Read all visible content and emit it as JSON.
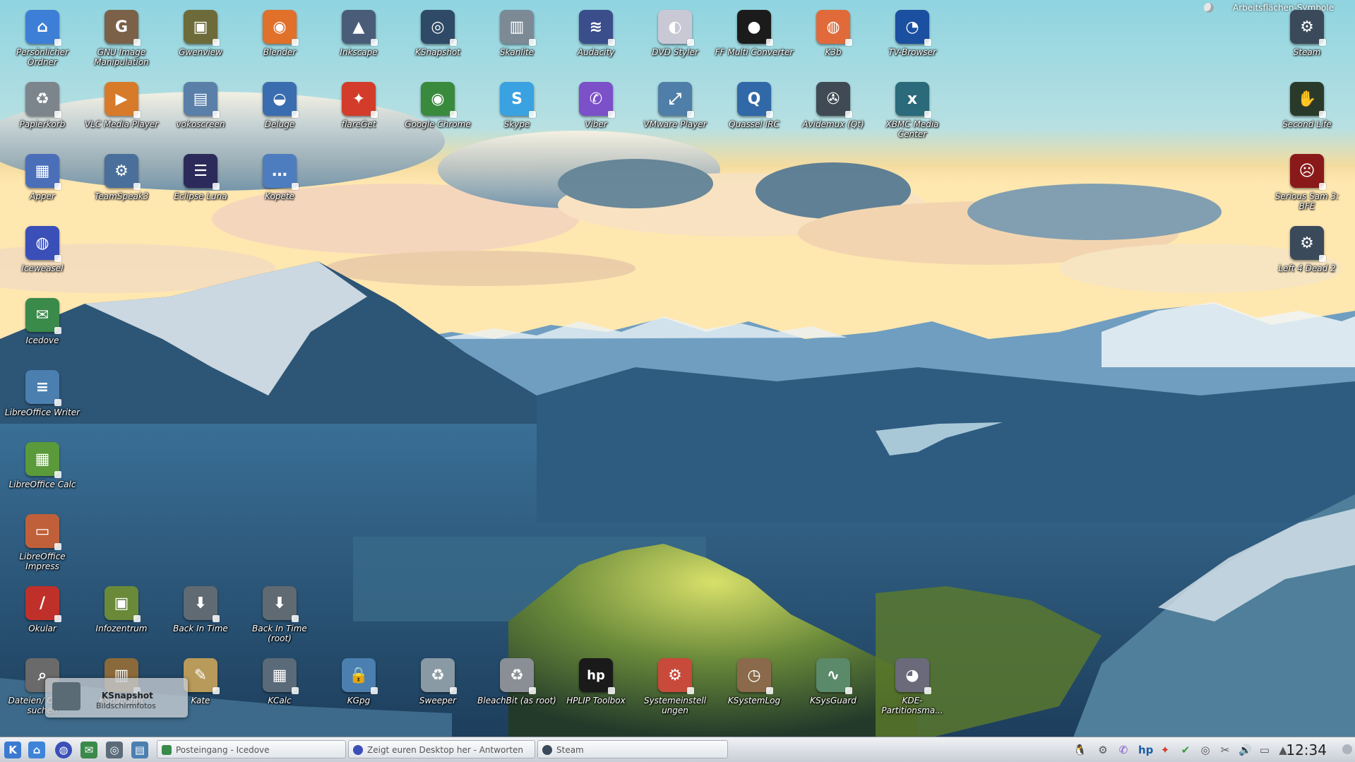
{
  "desktop": {
    "folderview_label": "Arbeitsflächen-Symbole",
    "icons": [
      {
        "id": "persoenlicher-ordner",
        "label": "Persönlicher Ordner",
        "color": "#3d7fd6",
        "glyph": "⌂"
      },
      {
        "id": "gimp",
        "label": "GNU Image Manipulation",
        "color": "#7a6148",
        "glyph": "G"
      },
      {
        "id": "gwenview",
        "label": "Gwenview",
        "color": "#6d6b3a",
        "glyph": "▣"
      },
      {
        "id": "blender",
        "label": "Blender",
        "color": "#e0702a",
        "glyph": "◉"
      },
      {
        "id": "inkscape",
        "label": "Inkscape",
        "color": "#4a5d78",
        "glyph": "▲"
      },
      {
        "id": "ksnapshot",
        "label": "KSnapshot",
        "color": "#2f4a66",
        "glyph": "◎"
      },
      {
        "id": "skanlite",
        "label": "Skanlite",
        "color": "#7c8a96",
        "glyph": "▥"
      },
      {
        "id": "audacity",
        "label": "Audacity",
        "color": "#3a4e8c",
        "glyph": "≋"
      },
      {
        "id": "dvd-styler",
        "label": "DVD Styler",
        "color": "#c9c9d6",
        "glyph": "◐"
      },
      {
        "id": "ff-multi-converter",
        "label": "FF Multi Converter",
        "color": "#1b1b1b",
        "glyph": "●"
      },
      {
        "id": "k3b",
        "label": "K3b",
        "color": "#e06a3a",
        "glyph": "◍"
      },
      {
        "id": "tv-browser",
        "label": "TV-Browser",
        "color": "#1b4fa0",
        "glyph": "◔"
      },
      {
        "id": "papierkorb",
        "label": "Papierkorb",
        "color": "#7d858c",
        "glyph": "♻"
      },
      {
        "id": "vlc",
        "label": "VLC Media Player",
        "color": "#d77a2a",
        "glyph": "▶"
      },
      {
        "id": "vokoscreen",
        "label": "vokoscreen",
        "color": "#5a7fa8",
        "glyph": "▤"
      },
      {
        "id": "deluge",
        "label": "Deluge",
        "color": "#3a6db0",
        "glyph": "◒"
      },
      {
        "id": "flareget",
        "label": "flareGet",
        "color": "#d33b2a",
        "glyph": "✦"
      },
      {
        "id": "google-chrome",
        "label": "Google Chrome",
        "color": "#3a8a3e",
        "glyph": "◉"
      },
      {
        "id": "skype",
        "label": "Skype",
        "color": "#3aa2e0",
        "glyph": "S"
      },
      {
        "id": "viber",
        "label": "Viber",
        "color": "#7b50c8",
        "glyph": "✆"
      },
      {
        "id": "vmware-player",
        "label": "VMware Player",
        "color": "#4f7fa8",
        "glyph": "⤢"
      },
      {
        "id": "quassel-irc",
        "label": "Quassel IRC",
        "color": "#3168a8",
        "glyph": "Q"
      },
      {
        "id": "avidemux",
        "label": "Avidemux (Qt)",
        "color": "#3f4a54",
        "glyph": "✇"
      },
      {
        "id": "xbmc",
        "label": "XBMC Media Center",
        "color": "#2a6a7a",
        "glyph": "x"
      },
      {
        "id": "apper",
        "label": "Apper",
        "color": "#4a6fb8",
        "glyph": "▦"
      },
      {
        "id": "teamspeak3",
        "label": "TeamSpeak3",
        "color": "#4a6f9a",
        "glyph": "⚙"
      },
      {
        "id": "eclipse-luna",
        "label": "Eclipse Luna",
        "color": "#2c2a5a",
        "glyph": "☰"
      },
      {
        "id": "kopete",
        "label": "Kopete",
        "color": "#4d7dbf",
        "glyph": "…"
      },
      {
        "id": "iceweasel",
        "label": "Iceweasel",
        "color": "#3b4fb8",
        "glyph": "◍"
      },
      {
        "id": "icedove",
        "label": "Icedove",
        "color": "#3a8a4a",
        "glyph": "✉"
      },
      {
        "id": "libreoffice-writer",
        "label": "LibreOffice Writer",
        "color": "#4a7fb0",
        "glyph": "≡"
      },
      {
        "id": "libreoffice-calc",
        "label": "LibreOffice Calc",
        "color": "#5a9a3a",
        "glyph": "▦"
      },
      {
        "id": "libreoffice-impress",
        "label": "LibreOffice Impress",
        "color": "#c0603a",
        "glyph": "▭"
      },
      {
        "id": "okular",
        "label": "Okular",
        "color": "#c0302a",
        "glyph": "/"
      },
      {
        "id": "infozentrum",
        "label": "Infozentrum",
        "color": "#6a8a3a",
        "glyph": "▣"
      },
      {
        "id": "back-in-time",
        "label": "Back In Time",
        "color": "#5f6a72",
        "glyph": "⬇"
      },
      {
        "id": "back-in-time-root",
        "label": "Back In Time (root)",
        "color": "#5f6a72",
        "glyph": "⬇"
      },
      {
        "id": "dateien-ordner-suchen",
        "label": "Dateien/ Ordner suchen",
        "color": "#6a6a6a",
        "glyph": "⌕"
      },
      {
        "id": "ksnapshot-2",
        "label": "KSnapshot",
        "color": "#8a6a3a",
        "glyph": "▥"
      },
      {
        "id": "kate",
        "label": "Kate",
        "color": "#b89a5a",
        "glyph": "✎"
      },
      {
        "id": "kcalc",
        "label": "KCalc",
        "color": "#5a6a78",
        "glyph": "▦"
      },
      {
        "id": "kgpg",
        "label": "KGpg",
        "color": "#4a7fb0",
        "glyph": "🔒"
      },
      {
        "id": "sweeper",
        "label": "Sweeper",
        "color": "#8a9aa4",
        "glyph": "♻"
      },
      {
        "id": "bleachbit-root",
        "label": "BleachBit (as root)",
        "color": "#8a8f96",
        "glyph": "♻"
      },
      {
        "id": "hplip-toolbox",
        "label": "HPLIP Toolbox",
        "color": "#1a1a1a",
        "glyph": "hp"
      },
      {
        "id": "systemeinstellungen",
        "label": "Systemeinstell ungen",
        "color": "#c84a3a",
        "glyph": "⚙"
      },
      {
        "id": "ksystemlog",
        "label": "KSystemLog",
        "color": "#8a6a4a",
        "glyph": "◷"
      },
      {
        "id": "ksysguard",
        "label": "KSysGuard",
        "color": "#5a8a6a",
        "glyph": "∿"
      },
      {
        "id": "kde-partitionsmanager",
        "label": "KDE-Partitionsma...",
        "color": "#6a6a7a",
        "glyph": "◕"
      },
      {
        "id": "steam",
        "label": "Steam",
        "color": "#3a4a5a",
        "glyph": "⚙"
      },
      {
        "id": "second-life",
        "label": "Second Life",
        "color": "#2a3a2a",
        "glyph": "✋"
      },
      {
        "id": "serious-sam",
        "label": "Serious Sam 3: BFE",
        "color": "#8a1a1a",
        "glyph": "☹"
      },
      {
        "id": "left-4-dead-2",
        "label": "Left 4 Dead 2",
        "color": "#3a4a5a",
        "glyph": "⚙"
      }
    ]
  },
  "tooltip": {
    "title": "KSnapshot",
    "subtitle": "Bildschirmfotos"
  },
  "taskbar": {
    "tasks": [
      {
        "label": "Posteingang - Icedove"
      },
      {
        "label": "Zeigt euren Desktop her - Antworten"
      },
      {
        "label": "Steam"
      }
    ],
    "clock": "12:34"
  }
}
